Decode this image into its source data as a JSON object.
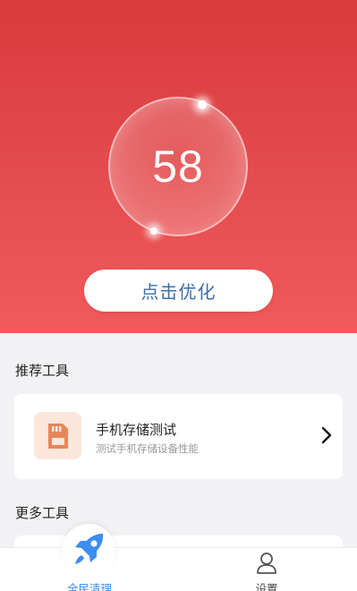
{
  "hero": {
    "score": "58",
    "optimize_label": "点击优化"
  },
  "recommended": {
    "title": "推荐工具",
    "tool": {
      "name": "手机存储测试",
      "description": "测试手机存储设备性能",
      "icon": "sd-card-icon"
    }
  },
  "more": {
    "title": "更多工具"
  },
  "bottom_nav": {
    "items": [
      {
        "label": "全民清理",
        "icon": "rocket-icon",
        "active": true
      },
      {
        "label": "设置",
        "icon": "user-icon",
        "active": false
      }
    ]
  },
  "colors": {
    "hero_top": "#d93a3c",
    "hero_bottom": "#f15a5c",
    "accent_blue": "#3b8ef0",
    "button_text": "#3b6fa8"
  }
}
